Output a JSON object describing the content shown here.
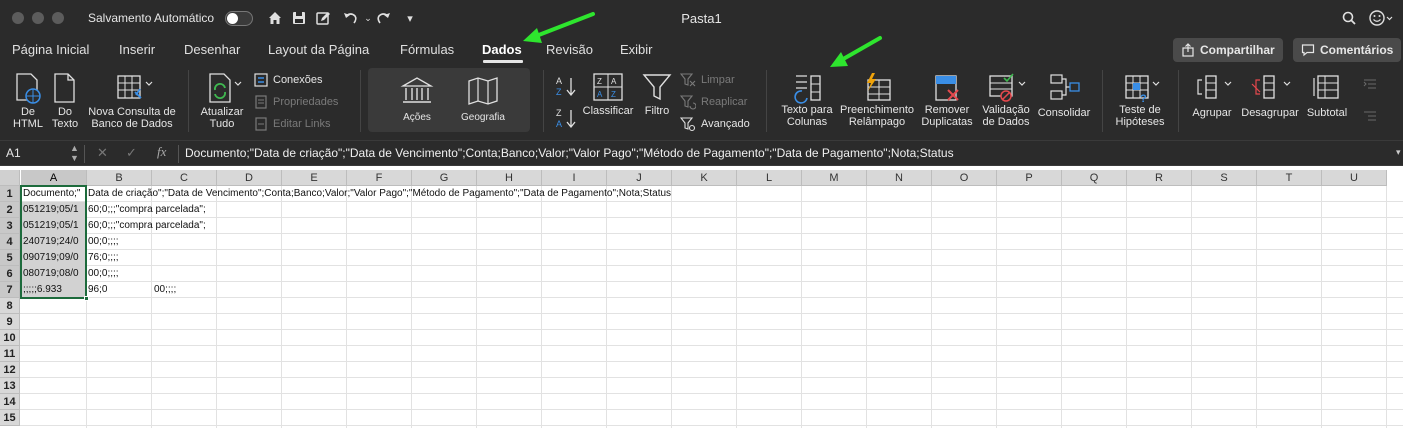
{
  "titlebar": {
    "autosave_label": "Salvamento Automático",
    "window_title": "Pasta1"
  },
  "tabs": [
    "Página Inicial",
    "Inserir",
    "Desenhar",
    "Layout da Página",
    "Fórmulas",
    "Dados",
    "Revisão",
    "Exibir"
  ],
  "active_tab": "Dados",
  "top_buttons": {
    "share": "Compartilhar",
    "comments": "Comentários"
  },
  "ribbon": {
    "from_html": [
      "De",
      "HTML"
    ],
    "from_text": [
      "Do",
      "Texto"
    ],
    "new_query": [
      "Nova Consulta de",
      "Banco de Dados"
    ],
    "refresh_all": [
      "Atualizar",
      "Tudo"
    ],
    "connections": "Conexões",
    "properties": "Propriedades",
    "edit_links": "Editar Links",
    "stocks": "Ações",
    "geography": "Geografia",
    "sort": "Classificar",
    "filter": "Filtro",
    "clear": "Limpar",
    "reapply": "Reaplicar",
    "advanced": "Avançado",
    "text_to_columns": [
      "Texto para",
      "Colunas"
    ],
    "flash_fill": [
      "Preenchimento",
      "Relâmpago"
    ],
    "remove_duplicates": [
      "Remover",
      "Duplicatas"
    ],
    "data_validation": [
      "Validação",
      "de Dados"
    ],
    "consolidate": "Consolidar",
    "what_if": [
      "Teste de",
      "Hipóteses"
    ],
    "group": "Agrupar",
    "ungroup": "Desagrupar",
    "subtotal": "Subtotal"
  },
  "formula_bar": {
    "name_box": "A1",
    "fx": "fx",
    "content": "Documento;\"Data de criação\";\"Data de Vencimento\";Conta;Banco;Valor;\"Valor Pago\";\"Método de Pagamento\";\"Data de Pagamento\";Nota;Status"
  },
  "grid": {
    "columns": [
      "A",
      "B",
      "C",
      "D",
      "E",
      "F",
      "G",
      "H",
      "I",
      "J",
      "K",
      "L",
      "M",
      "N",
      "O",
      "P",
      "Q",
      "R",
      "S",
      "T",
      "U"
    ],
    "rows": [
      "1",
      "2",
      "3",
      "4",
      "5",
      "6",
      "7",
      "8",
      "9",
      "10",
      "11",
      "12",
      "13",
      "14",
      "15"
    ],
    "cells": [
      {
        "a": "Documento;\"",
        "b": "Data de criação\";\"Data de Vencimento\";Conta;Banco;Valor;\"Valor Pago\";\"Método de Pagamento\";\"Data de Pagamento\";Nota;Status",
        "c": ""
      },
      {
        "a": "051219;05/1",
        "b": "60;0;;;\"compra parcelada\";",
        "c": ""
      },
      {
        "a": "051219;05/1",
        "b": "60;0;;;\"compra parcelada\";",
        "c": ""
      },
      {
        "a": "240719;24/0",
        "b": "00;0;;;;",
        "c": ""
      },
      {
        "a": "090719;09/0",
        "b": "76;0;;;;",
        "c": ""
      },
      {
        "a": "080719;08/0",
        "b": "00;0;;;;",
        "c": ""
      },
      {
        "a": ";;;;;6.933",
        "b": "96;0",
        "c": "00;;;;"
      }
    ]
  }
}
